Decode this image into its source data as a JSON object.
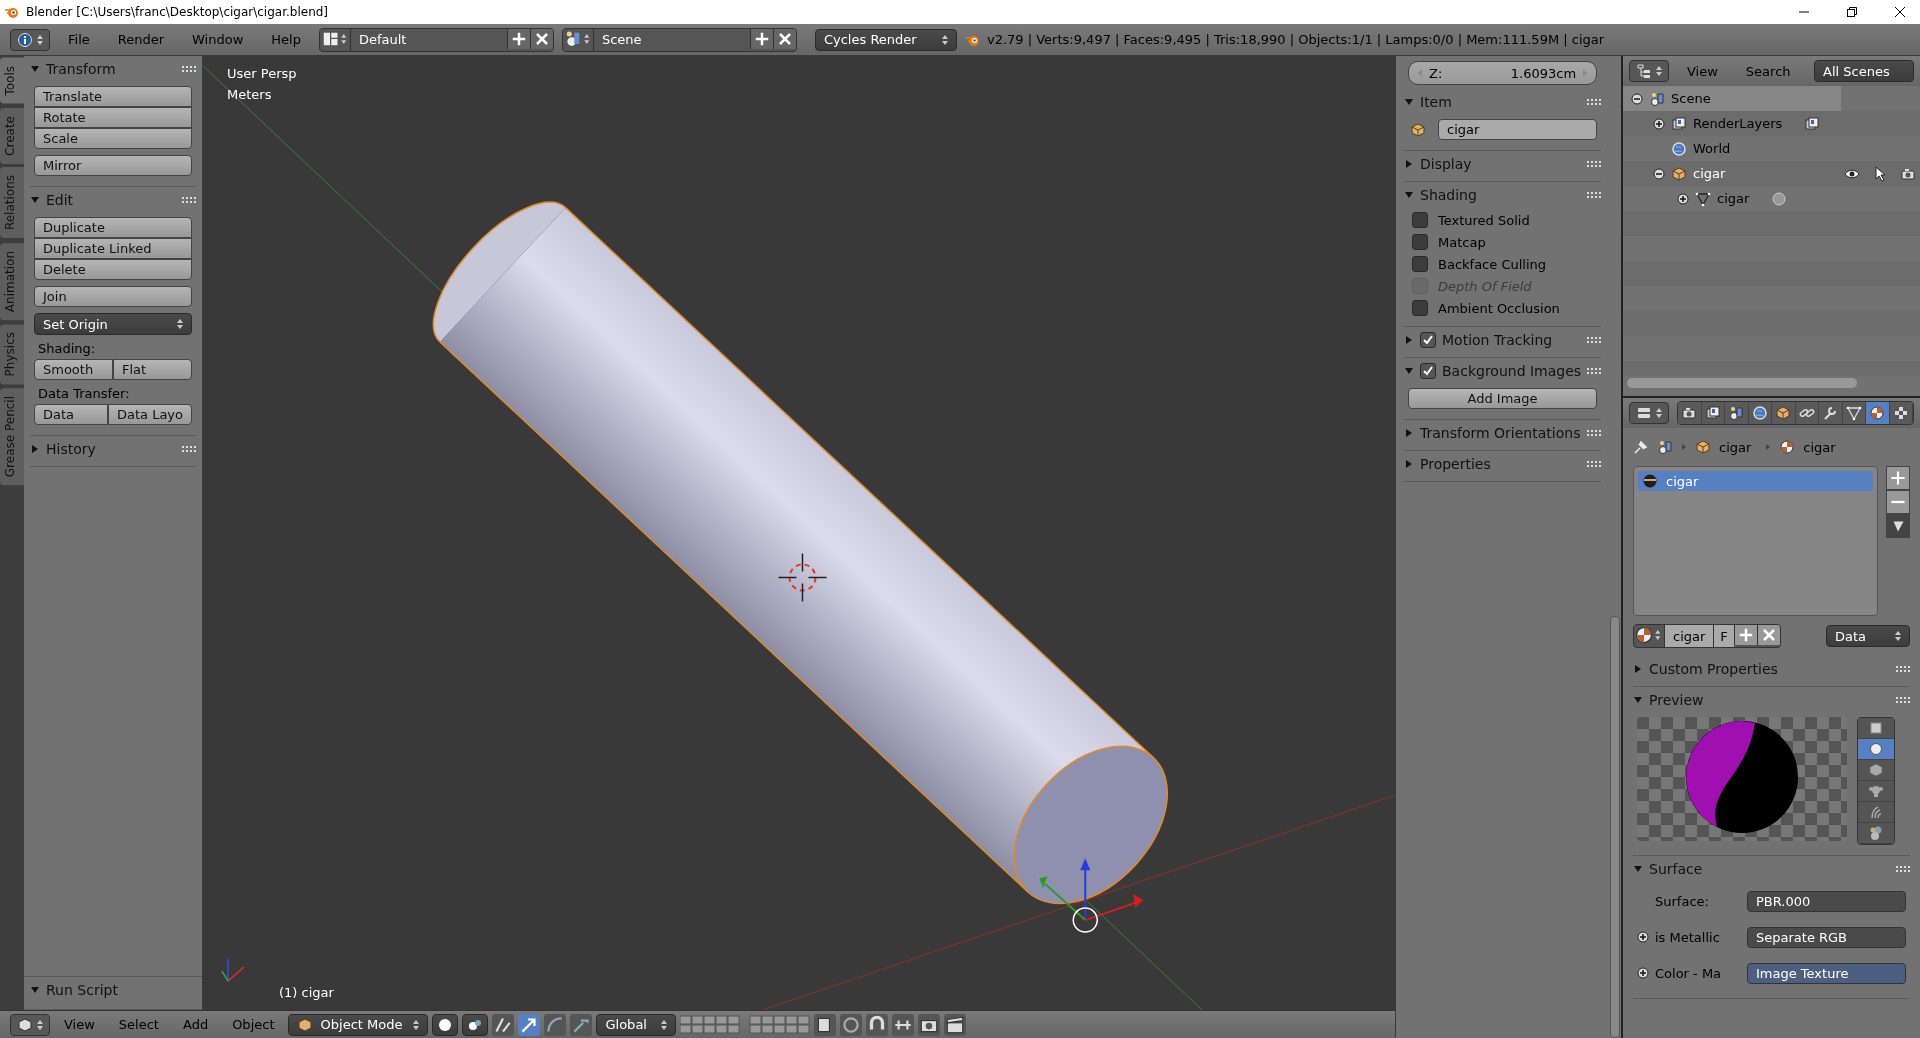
{
  "title_bar": {
    "title": "Blender [C:\\Users\\franc\\Desktop\\cigar\\cigar.blend]"
  },
  "info_header": {
    "menus": [
      "File",
      "Render",
      "Window",
      "Help"
    ],
    "screen_layout": "Default",
    "scene": "Scene",
    "render_engine": "Cycles Render",
    "stats": "v2.79 | Verts:9,497 | Faces:9,495 | Tris:18,990 | Objects:1/1 | Lamps:0/0 | Mem:111.59M | cigar"
  },
  "tool_tabs": [
    {
      "label": "Tools",
      "selected": true
    },
    {
      "label": "Create",
      "selected": false
    },
    {
      "label": "Relations",
      "selected": false
    },
    {
      "label": "Animation",
      "selected": false
    },
    {
      "label": "Physics",
      "selected": false
    },
    {
      "label": "Grease Pencil",
      "selected": false
    }
  ],
  "tool_shelf": {
    "panels": [
      {
        "title": "Transform",
        "expanded": true,
        "rows": [
          {
            "kind": "stack",
            "items": [
              "Translate",
              "Rotate",
              "Scale"
            ]
          },
          {
            "kind": "stack",
            "items": [
              "Mirror"
            ]
          }
        ]
      },
      {
        "title": "Edit",
        "expanded": true,
        "rows": [
          {
            "kind": "stack",
            "items": [
              "Duplicate",
              "Duplicate Linked",
              "Delete"
            ]
          },
          {
            "kind": "stack",
            "items": [
              "Join"
            ]
          },
          {
            "kind": "dropdown",
            "text": "Set Origin"
          },
          {
            "kind": "label",
            "text": "Shading:"
          },
          {
            "kind": "pair",
            "items": [
              "Smooth",
              "Flat"
            ]
          },
          {
            "kind": "label",
            "text": "Data Transfer:"
          },
          {
            "kind": "pair",
            "items": [
              "Data",
              "Data Layo"
            ]
          }
        ]
      },
      {
        "title": "History",
        "expanded": false
      }
    ],
    "footer_panel": {
      "title": "Run Script",
      "expanded": true
    }
  },
  "viewport": {
    "view_name": "User Persp",
    "units": "Meters",
    "object_label": "(1) cigar"
  },
  "view_header": {
    "menus": [
      "View",
      "Select",
      "Add",
      "Object"
    ],
    "mode": "Object Mode",
    "orientation": "Global"
  },
  "n_panel": {
    "z_field": {
      "label": "Z:",
      "value": "1.6093cm"
    },
    "panels": [
      {
        "kind": "item",
        "title": "Item",
        "expanded": true,
        "name": "cigar"
      },
      {
        "title": "Display",
        "expanded": false
      },
      {
        "kind": "shading",
        "title": "Shading",
        "expanded": true,
        "options": [
          {
            "label": "Textured Solid",
            "checked": false,
            "disabled": false
          },
          {
            "label": "Matcap",
            "checked": false,
            "disabled": false
          },
          {
            "label": "Backface Culling",
            "checked": false,
            "disabled": false
          },
          {
            "label": "Depth Of Field",
            "checked": false,
            "disabled": true
          },
          {
            "label": "Ambient Occlusion",
            "checked": false,
            "disabled": false
          }
        ]
      },
      {
        "kind": "toggle",
        "title": "Motion Tracking",
        "expanded": false,
        "checked": true
      },
      {
        "kind": "background",
        "title": "Background Images",
        "expanded": true,
        "checked": true,
        "button": "Add Image"
      },
      {
        "title": "Transform Orientations",
        "expanded": false
      },
      {
        "title": "Properties",
        "expanded": false
      }
    ]
  },
  "outliner": {
    "menus": [
      "View",
      "Search"
    ],
    "filter": "All Scenes",
    "tree": [
      {
        "kind": "scene",
        "label": "Scene",
        "expanded": true,
        "highlighted": true,
        "selected": false,
        "children": [
          {
            "kind": "render_layers",
            "label": "RenderLayers",
            "expanded": false,
            "highlighted": false,
            "selected": false
          },
          {
            "kind": "world",
            "label": "World",
            "highlighted": false,
            "selected": false
          },
          {
            "kind": "object",
            "label": "cigar",
            "expanded": true,
            "highlighted": false,
            "selected": true,
            "children": [
              {
                "kind": "mesh",
                "label": "cigar",
                "expanded": false,
                "highlighted": false,
                "selected": false
              }
            ]
          }
        ]
      }
    ]
  },
  "properties": {
    "tabs": [
      {
        "kind": "render",
        "selected": false
      },
      {
        "kind": "render_layers",
        "selected": false
      },
      {
        "kind": "scene",
        "selected": false
      },
      {
        "kind": "world",
        "selected": false
      },
      {
        "kind": "object",
        "selected": false
      },
      {
        "kind": "constraints",
        "selected": false
      },
      {
        "kind": "modifiers",
        "selected": false
      },
      {
        "kind": "data",
        "selected": false
      },
      {
        "kind": "material",
        "selected": true
      },
      {
        "kind": "texture",
        "selected": false
      }
    ],
    "breadcrumb": [
      "cigar",
      "cigar"
    ],
    "slots": [
      {
        "name": "cigar",
        "selected": true
      }
    ],
    "material": {
      "name": "cigar",
      "fake_user": "F",
      "link": "Data"
    },
    "panels": [
      {
        "title": "Custom Properties",
        "expanded": false
      },
      {
        "kind": "preview",
        "title": "Preview",
        "expanded": true,
        "shapes": [
          {
            "kind": "flat",
            "selected": false
          },
          {
            "kind": "sphere",
            "selected": true
          },
          {
            "kind": "cube",
            "selected": false
          },
          {
            "kind": "monkey",
            "selected": false
          },
          {
            "kind": "hair",
            "selected": false
          },
          {
            "kind": "sky",
            "selected": false
          }
        ]
      },
      {
        "kind": "surface",
        "title": "Surface",
        "expanded": true,
        "fields": [
          {
            "label": "Surface:",
            "value": "PBR.000",
            "highlighted": false
          },
          {
            "label": "is Metallic",
            "value": "Separate RGB",
            "socket": true,
            "highlighted": false
          },
          {
            "label": "Color - Ma",
            "value": "Image Texture",
            "socket": true,
            "highlighted": true
          }
        ]
      }
    ]
  }
}
